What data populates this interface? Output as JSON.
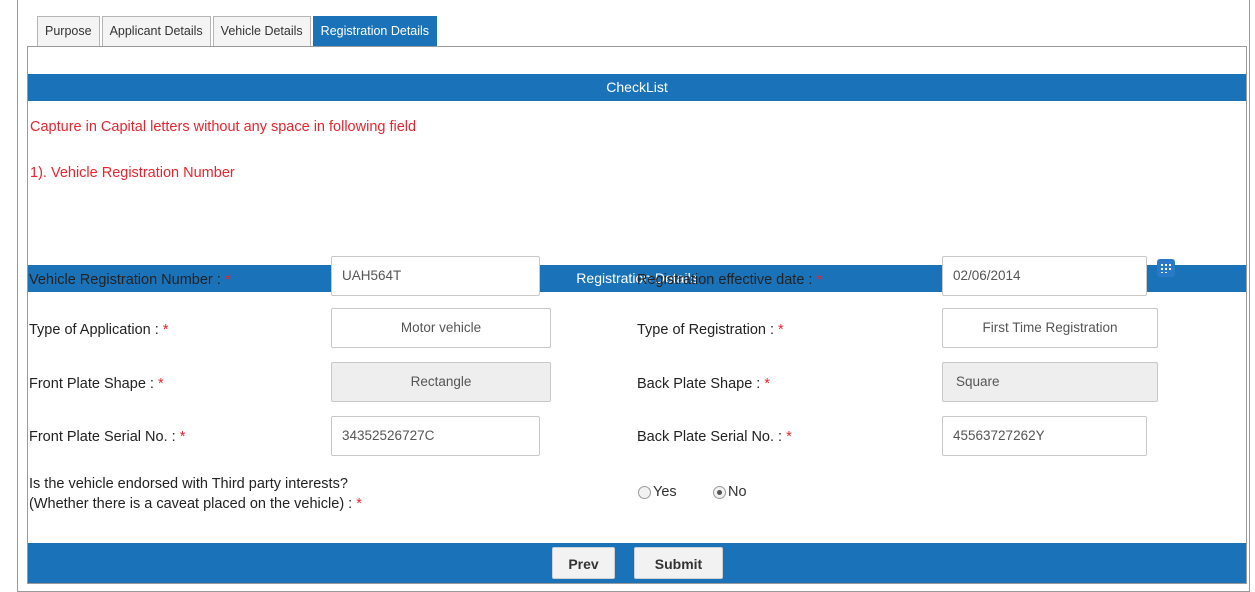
{
  "tabs": [
    {
      "label": "Purpose",
      "active": false
    },
    {
      "label": "Applicant Details",
      "active": false
    },
    {
      "label": "Vehicle Details",
      "active": false
    },
    {
      "label": "Registration Details",
      "active": true
    }
  ],
  "checklist": {
    "title": "CheckList",
    "line1": "Capture in Capital letters without any space in following field",
    "line2": "1). Vehicle Registration Number"
  },
  "registration": {
    "title": "Registration Details",
    "required_mark": "*",
    "vehicle_reg_number": {
      "label": "Vehicle Registration Number :",
      "value": "UAH564T"
    },
    "effective_date": {
      "label": "Registration effective date :",
      "value": "02/06/2014"
    },
    "type_of_application": {
      "label": "Type of Application :",
      "value": "Motor vehicle"
    },
    "type_of_registration": {
      "label": "Type of Registration :",
      "value": "First Time Registration"
    },
    "front_plate_shape": {
      "label": "Front Plate Shape :",
      "value": "Rectangle"
    },
    "back_plate_shape": {
      "label": "Back Plate Shape :",
      "value": "Square"
    },
    "front_plate_serial": {
      "label": "Front Plate Serial No. :",
      "value": "34352526727C"
    },
    "back_plate_serial": {
      "label": "Back Plate Serial No. :",
      "value": "45563727262Y"
    },
    "third_party": {
      "label_line1": "Is the vehicle endorsed with Third party interests?",
      "label_line2": "(Whether there is a caveat placed on the vehicle) :",
      "option_yes": "Yes",
      "option_no": "No",
      "selected": "No"
    }
  },
  "buttons": {
    "prev": "Prev",
    "submit": "Submit"
  },
  "colors": {
    "accent": "#1a73b8",
    "required": "#e8252f"
  }
}
